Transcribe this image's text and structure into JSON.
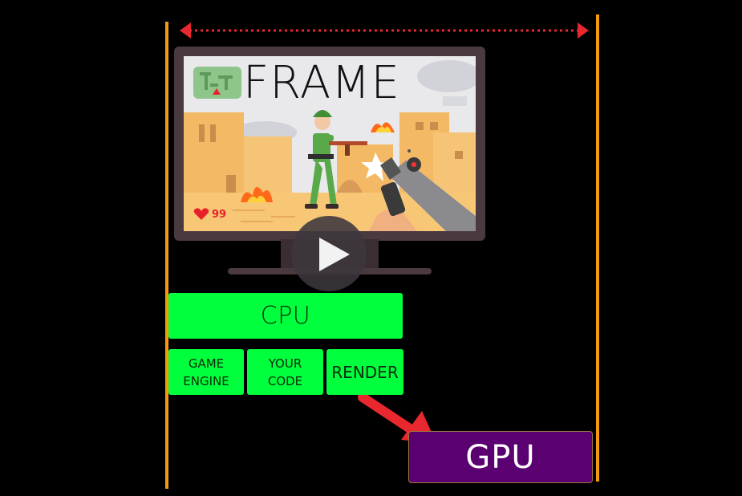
{
  "frame": {
    "title": "FRAME",
    "health_value": "99"
  },
  "cpu": {
    "label": "CPU"
  },
  "components": [
    {
      "label": "GAME\nENGINE"
    },
    {
      "label": "YOUR\nCODE"
    },
    {
      "label": "RENDER"
    }
  ],
  "gpu": {
    "label": "GPU"
  },
  "colors": {
    "bracket_line": "#f59a0c",
    "dimension_arrow": "#e8282e",
    "cpu_green": "#00ff3c",
    "gpu_purple": "#5a0070",
    "pointer_arrow": "#e8282e",
    "monitor_frame": "#4a3a40",
    "sky": "#e8e8ea",
    "sand": "#f5c476"
  },
  "icons": {
    "play": "play-icon",
    "heart": "heart-icon",
    "minimap": "minimap-icon"
  }
}
